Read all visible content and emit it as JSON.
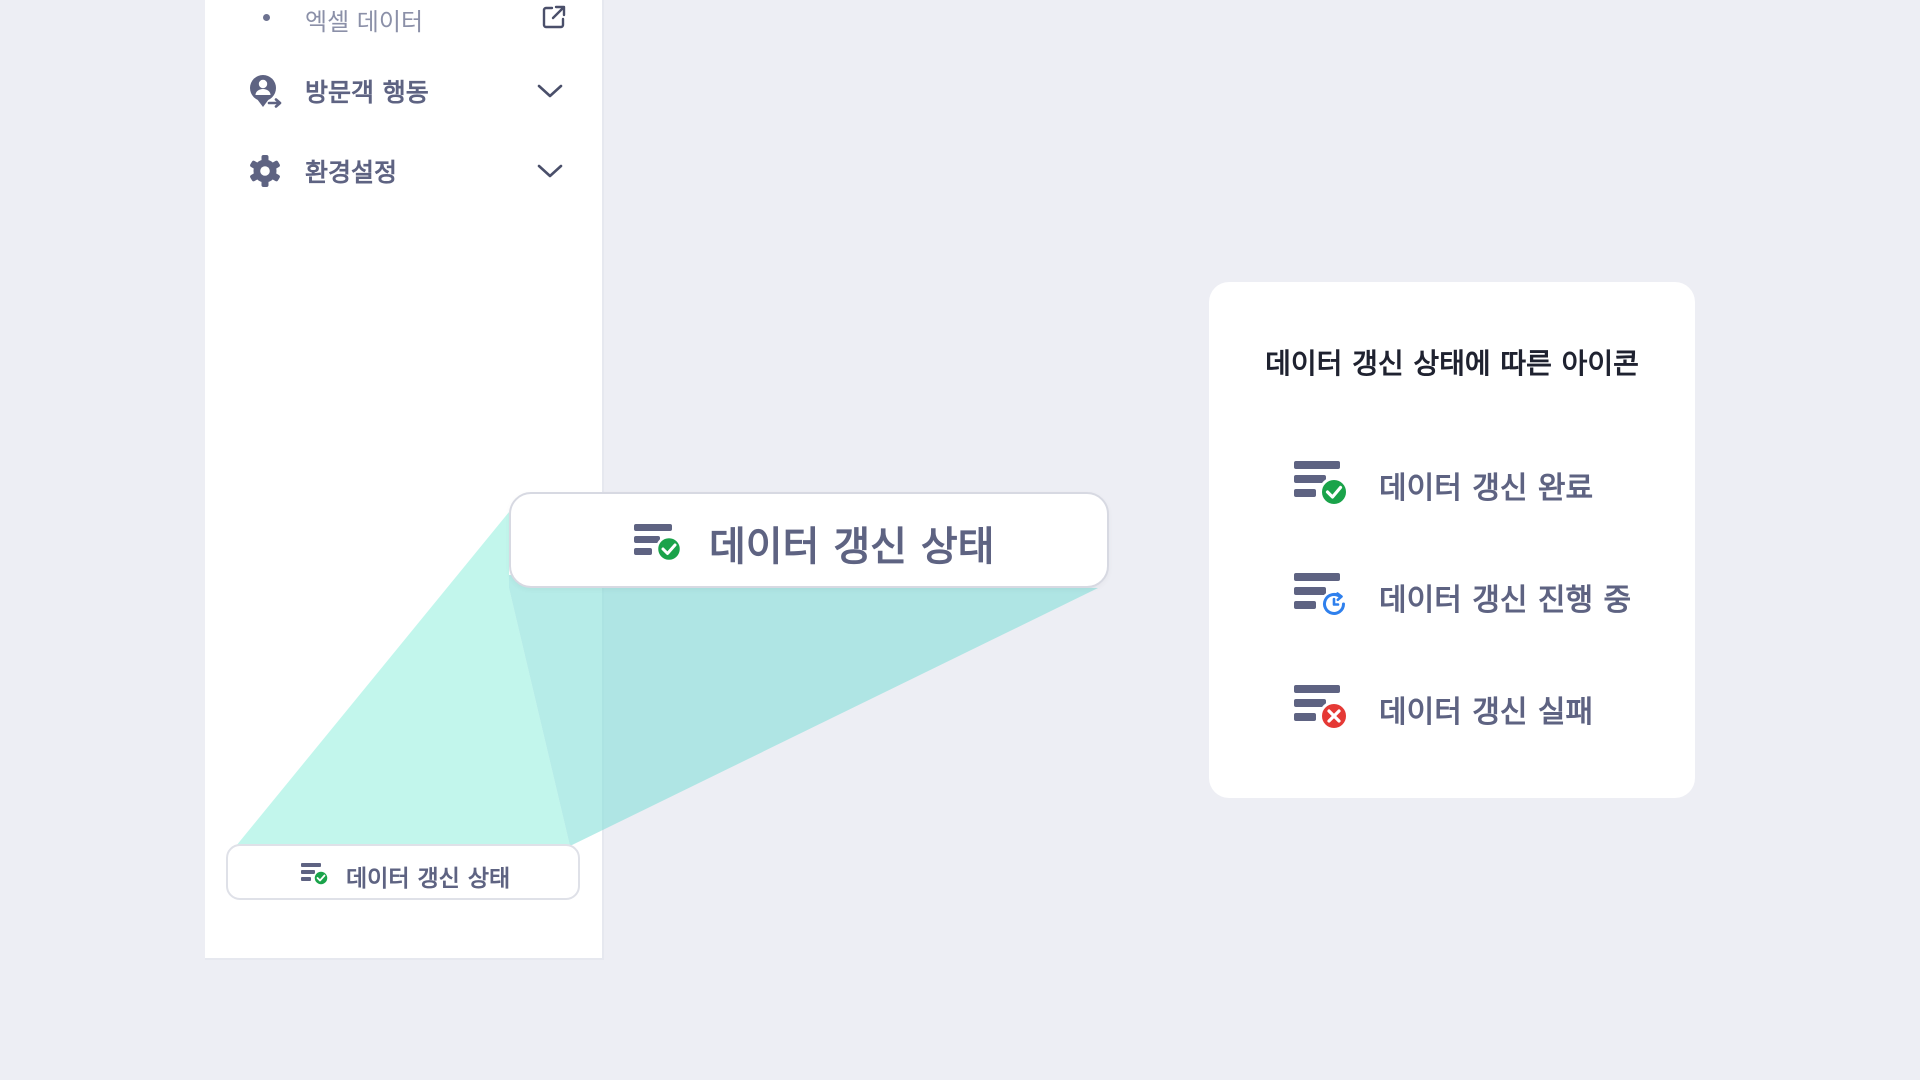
{
  "sidebar": {
    "sub_item": {
      "label": "엑셀 데이터",
      "icon": "external-link-icon"
    },
    "nav_items": [
      {
        "label": "방문객 행동",
        "icon": "visitor-icon"
      },
      {
        "label": "환경설정",
        "icon": "gear-icon"
      }
    ],
    "status_button": {
      "label": "데이터 갱신 상태",
      "icon": "data-refresh-success-icon"
    }
  },
  "zoom_callout": {
    "label": "데이터 갱신 상태",
    "icon": "data-refresh-success-icon"
  },
  "legend": {
    "title": "데이터 갱신 상태에 따른 아이콘",
    "items": [
      {
        "label": "데이터 갱신 완료",
        "icon": "data-refresh-success-icon",
        "color": "#1aa34a"
      },
      {
        "label": "데이터 갱신 진행 중",
        "icon": "data-refresh-progress-icon",
        "color": "#2f80ed"
      },
      {
        "label": "데이터 갱신 실패",
        "icon": "data-refresh-fail-icon",
        "color": "#e53935"
      }
    ]
  },
  "colors": {
    "background": "#edeef4",
    "text": "#5e6382",
    "highlight_beam": "#7ee8d6"
  }
}
